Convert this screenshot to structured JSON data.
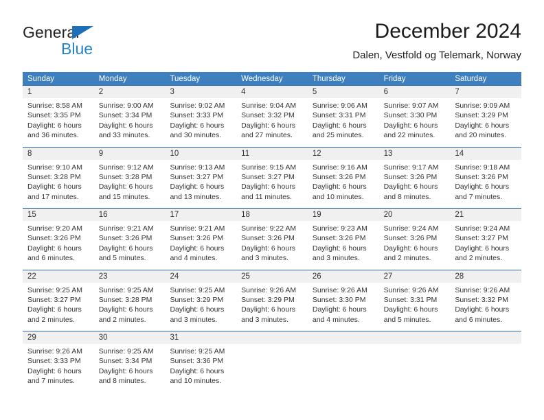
{
  "brand": {
    "name_part1": "General",
    "name_part2": "Blue",
    "logo_icon": "triangle-logo-icon",
    "accent_color": "#1d6fb8",
    "blue_text_color": "#2683c8"
  },
  "header": {
    "title": "December 2024",
    "subtitle": "Dalen, Vestfold og Telemark, Norway"
  },
  "calendar": {
    "header_bg": "#3d7fbf",
    "row_border": "#2a6aac",
    "daynum_bg": "#f0f0f0",
    "weekdays": [
      "Sunday",
      "Monday",
      "Tuesday",
      "Wednesday",
      "Thursday",
      "Friday",
      "Saturday"
    ],
    "weeks": [
      [
        {
          "day": "1",
          "sunrise": "Sunrise: 8:58 AM",
          "sunset": "Sunset: 3:35 PM",
          "daylight1": "Daylight: 6 hours",
          "daylight2": "and 36 minutes."
        },
        {
          "day": "2",
          "sunrise": "Sunrise: 9:00 AM",
          "sunset": "Sunset: 3:34 PM",
          "daylight1": "Daylight: 6 hours",
          "daylight2": "and 33 minutes."
        },
        {
          "day": "3",
          "sunrise": "Sunrise: 9:02 AM",
          "sunset": "Sunset: 3:33 PM",
          "daylight1": "Daylight: 6 hours",
          "daylight2": "and 30 minutes."
        },
        {
          "day": "4",
          "sunrise": "Sunrise: 9:04 AM",
          "sunset": "Sunset: 3:32 PM",
          "daylight1": "Daylight: 6 hours",
          "daylight2": "and 27 minutes."
        },
        {
          "day": "5",
          "sunrise": "Sunrise: 9:06 AM",
          "sunset": "Sunset: 3:31 PM",
          "daylight1": "Daylight: 6 hours",
          "daylight2": "and 25 minutes."
        },
        {
          "day": "6",
          "sunrise": "Sunrise: 9:07 AM",
          "sunset": "Sunset: 3:30 PM",
          "daylight1": "Daylight: 6 hours",
          "daylight2": "and 22 minutes."
        },
        {
          "day": "7",
          "sunrise": "Sunrise: 9:09 AM",
          "sunset": "Sunset: 3:29 PM",
          "daylight1": "Daylight: 6 hours",
          "daylight2": "and 20 minutes."
        }
      ],
      [
        {
          "day": "8",
          "sunrise": "Sunrise: 9:10 AM",
          "sunset": "Sunset: 3:28 PM",
          "daylight1": "Daylight: 6 hours",
          "daylight2": "and 17 minutes."
        },
        {
          "day": "9",
          "sunrise": "Sunrise: 9:12 AM",
          "sunset": "Sunset: 3:28 PM",
          "daylight1": "Daylight: 6 hours",
          "daylight2": "and 15 minutes."
        },
        {
          "day": "10",
          "sunrise": "Sunrise: 9:13 AM",
          "sunset": "Sunset: 3:27 PM",
          "daylight1": "Daylight: 6 hours",
          "daylight2": "and 13 minutes."
        },
        {
          "day": "11",
          "sunrise": "Sunrise: 9:15 AM",
          "sunset": "Sunset: 3:27 PM",
          "daylight1": "Daylight: 6 hours",
          "daylight2": "and 11 minutes."
        },
        {
          "day": "12",
          "sunrise": "Sunrise: 9:16 AM",
          "sunset": "Sunset: 3:26 PM",
          "daylight1": "Daylight: 6 hours",
          "daylight2": "and 10 minutes."
        },
        {
          "day": "13",
          "sunrise": "Sunrise: 9:17 AM",
          "sunset": "Sunset: 3:26 PM",
          "daylight1": "Daylight: 6 hours",
          "daylight2": "and 8 minutes."
        },
        {
          "day": "14",
          "sunrise": "Sunrise: 9:18 AM",
          "sunset": "Sunset: 3:26 PM",
          "daylight1": "Daylight: 6 hours",
          "daylight2": "and 7 minutes."
        }
      ],
      [
        {
          "day": "15",
          "sunrise": "Sunrise: 9:20 AM",
          "sunset": "Sunset: 3:26 PM",
          "daylight1": "Daylight: 6 hours",
          "daylight2": "and 6 minutes."
        },
        {
          "day": "16",
          "sunrise": "Sunrise: 9:21 AM",
          "sunset": "Sunset: 3:26 PM",
          "daylight1": "Daylight: 6 hours",
          "daylight2": "and 5 minutes."
        },
        {
          "day": "17",
          "sunrise": "Sunrise: 9:21 AM",
          "sunset": "Sunset: 3:26 PM",
          "daylight1": "Daylight: 6 hours",
          "daylight2": "and 4 minutes."
        },
        {
          "day": "18",
          "sunrise": "Sunrise: 9:22 AM",
          "sunset": "Sunset: 3:26 PM",
          "daylight1": "Daylight: 6 hours",
          "daylight2": "and 3 minutes."
        },
        {
          "day": "19",
          "sunrise": "Sunrise: 9:23 AM",
          "sunset": "Sunset: 3:26 PM",
          "daylight1": "Daylight: 6 hours",
          "daylight2": "and 3 minutes."
        },
        {
          "day": "20",
          "sunrise": "Sunrise: 9:24 AM",
          "sunset": "Sunset: 3:26 PM",
          "daylight1": "Daylight: 6 hours",
          "daylight2": "and 2 minutes."
        },
        {
          "day": "21",
          "sunrise": "Sunrise: 9:24 AM",
          "sunset": "Sunset: 3:27 PM",
          "daylight1": "Daylight: 6 hours",
          "daylight2": "and 2 minutes."
        }
      ],
      [
        {
          "day": "22",
          "sunrise": "Sunrise: 9:25 AM",
          "sunset": "Sunset: 3:27 PM",
          "daylight1": "Daylight: 6 hours",
          "daylight2": "and 2 minutes."
        },
        {
          "day": "23",
          "sunrise": "Sunrise: 9:25 AM",
          "sunset": "Sunset: 3:28 PM",
          "daylight1": "Daylight: 6 hours",
          "daylight2": "and 2 minutes."
        },
        {
          "day": "24",
          "sunrise": "Sunrise: 9:25 AM",
          "sunset": "Sunset: 3:29 PM",
          "daylight1": "Daylight: 6 hours",
          "daylight2": "and 3 minutes."
        },
        {
          "day": "25",
          "sunrise": "Sunrise: 9:26 AM",
          "sunset": "Sunset: 3:29 PM",
          "daylight1": "Daylight: 6 hours",
          "daylight2": "and 3 minutes."
        },
        {
          "day": "26",
          "sunrise": "Sunrise: 9:26 AM",
          "sunset": "Sunset: 3:30 PM",
          "daylight1": "Daylight: 6 hours",
          "daylight2": "and 4 minutes."
        },
        {
          "day": "27",
          "sunrise": "Sunrise: 9:26 AM",
          "sunset": "Sunset: 3:31 PM",
          "daylight1": "Daylight: 6 hours",
          "daylight2": "and 5 minutes."
        },
        {
          "day": "28",
          "sunrise": "Sunrise: 9:26 AM",
          "sunset": "Sunset: 3:32 PM",
          "daylight1": "Daylight: 6 hours",
          "daylight2": "and 6 minutes."
        }
      ],
      [
        {
          "day": "29",
          "sunrise": "Sunrise: 9:26 AM",
          "sunset": "Sunset: 3:33 PM",
          "daylight1": "Daylight: 6 hours",
          "daylight2": "and 7 minutes."
        },
        {
          "day": "30",
          "sunrise": "Sunrise: 9:25 AM",
          "sunset": "Sunset: 3:34 PM",
          "daylight1": "Daylight: 6 hours",
          "daylight2": "and 8 minutes."
        },
        {
          "day": "31",
          "sunrise": "Sunrise: 9:25 AM",
          "sunset": "Sunset: 3:36 PM",
          "daylight1": "Daylight: 6 hours",
          "daylight2": "and 10 minutes."
        },
        {
          "day": "",
          "sunrise": "",
          "sunset": "",
          "daylight1": "",
          "daylight2": ""
        },
        {
          "day": "",
          "sunrise": "",
          "sunset": "",
          "daylight1": "",
          "daylight2": ""
        },
        {
          "day": "",
          "sunrise": "",
          "sunset": "",
          "daylight1": "",
          "daylight2": ""
        },
        {
          "day": "",
          "sunrise": "",
          "sunset": "",
          "daylight1": "",
          "daylight2": ""
        }
      ]
    ]
  }
}
